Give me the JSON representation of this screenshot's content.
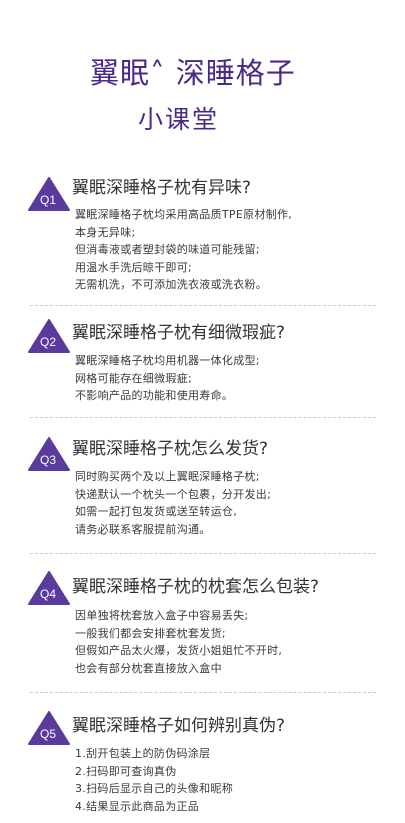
{
  "header": {
    "title": "翼眠˄ 深睡格子",
    "subtitle": "小课堂"
  },
  "faq": [
    {
      "badge": "Q1",
      "question": "翼眠深睡格子枕有异味?",
      "answer": [
        "翼眠深睡格子枕均采用高品质TPE原材制作,",
        "本身无异味;",
        "但消毒液或者塑封袋的味道可能残留;",
        "用温水手洗后晾干即可;",
        "无需机洗，不可添加洗衣液或洗衣粉。"
      ]
    },
    {
      "badge": "Q2",
      "question": "翼眠深睡格子枕有细微瑕疵?",
      "answer": [
        "翼眠深睡格子枕均用机器一体化成型;",
        "网格可能存在细微瑕疵;",
        "不影响产品的功能和使用寿命。"
      ]
    },
    {
      "badge": "Q3",
      "question": "翼眠深睡格子枕怎么发货?",
      "answer": [
        "同时购买两个及以上翼眠深睡格子枕;",
        "快递默认一个枕头一个包裹，分开发出;",
        "如需一起打包发货或送至转运仓,",
        "请务必联系客服提前沟通。"
      ]
    },
    {
      "badge": "Q4",
      "question": "翼眠深睡格子枕的枕套怎么包装?",
      "answer": [
        "因单独将枕套放入盒子中容易丢失;",
        "一般我们都会安排套枕套发货;",
        "但假如产品太火爆，发货小姐姐忙不开时,",
        "也会有部分枕套直接放入盒中"
      ]
    },
    {
      "badge": "Q5",
      "question": "翼眠深睡格子如何辨别真伪?",
      "answer": [
        "1.刮开包装上的防伪码涂层",
        "2.扫码即可查询真伪",
        "3.扫码后显示自己的头像和昵称",
        "4.结果显示此商品为正品"
      ]
    }
  ],
  "colors": {
    "accent": "#4a2a86",
    "badge": "#5b3a9e",
    "text": "#3a3a3a",
    "divider": "#c9c9c9"
  }
}
